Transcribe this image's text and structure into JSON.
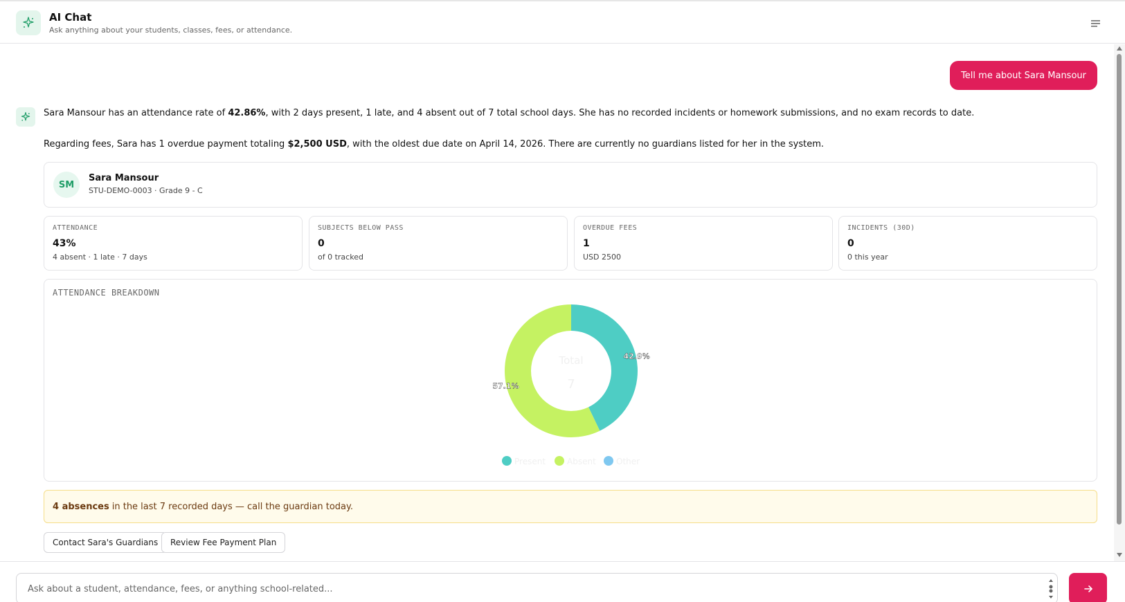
{
  "header": {
    "title": "AI Chat",
    "subtitle": "Ask anything about your students, classes, fees, or attendance.",
    "logo_icon": "sparkles-icon",
    "menu_icon": "menu-icon"
  },
  "messages": {
    "user": "Tell me about Sara Mansour",
    "para1": {
      "pre": "Sara Mansour has an attendance rate of ",
      "bold": "42.86%",
      "post": ", with 2 days present, 1 late, and 4 absent out of 7 total school days. She has no recorded incidents or homework submissions, and no exam records to date."
    },
    "para2": {
      "pre": "Regarding fees, Sara has 1 overdue payment totaling ",
      "bold": "$2,500 USD",
      "post": ", with the oldest due date on April 14, 2026. There are currently no guardians listed for her in the system."
    }
  },
  "student": {
    "initials": "SM",
    "name": "Sara Mansour",
    "meta": "STU-DEMO-0003 · Grade 9 - C"
  },
  "stats": [
    {
      "label": "ATTENDANCE",
      "value": "43%",
      "sub": "4 absent · 1 late · 7 days"
    },
    {
      "label": "SUBJECTS BELOW PASS",
      "value": "0",
      "sub": "of 0 tracked"
    },
    {
      "label": "OVERDUE FEES",
      "value": "1",
      "sub": "USD 2500"
    },
    {
      "label": "INCIDENTS (30D)",
      "value": "0",
      "sub": "0 this year"
    }
  ],
  "chart_title": "ATTENDANCE BREAKDOWN",
  "chart_data": {
    "type": "pie",
    "title": "ATTENDANCE BREAKDOWN",
    "center_label": "Total",
    "center_value": "7",
    "categories": [
      "Present",
      "Absent",
      "Other"
    ],
    "values": [
      42.9,
      57.1,
      0
    ],
    "data_labels": [
      "42.9%",
      "57.1%",
      ""
    ],
    "colors": [
      "#4ecdc4",
      "#c5f262",
      "#7fc8f0"
    ],
    "legend": "bottom"
  },
  "alert": {
    "bold": "4 absences",
    "text": "in the last 7 recorded days — call the guardian today."
  },
  "actions": [
    "Contact Sara's Guardians",
    "Review Fee Payment Plan"
  ],
  "composer": {
    "placeholder": "Ask about a student, attendance, fees, or anything school-related...",
    "send_icon": "arrow-right-icon"
  }
}
